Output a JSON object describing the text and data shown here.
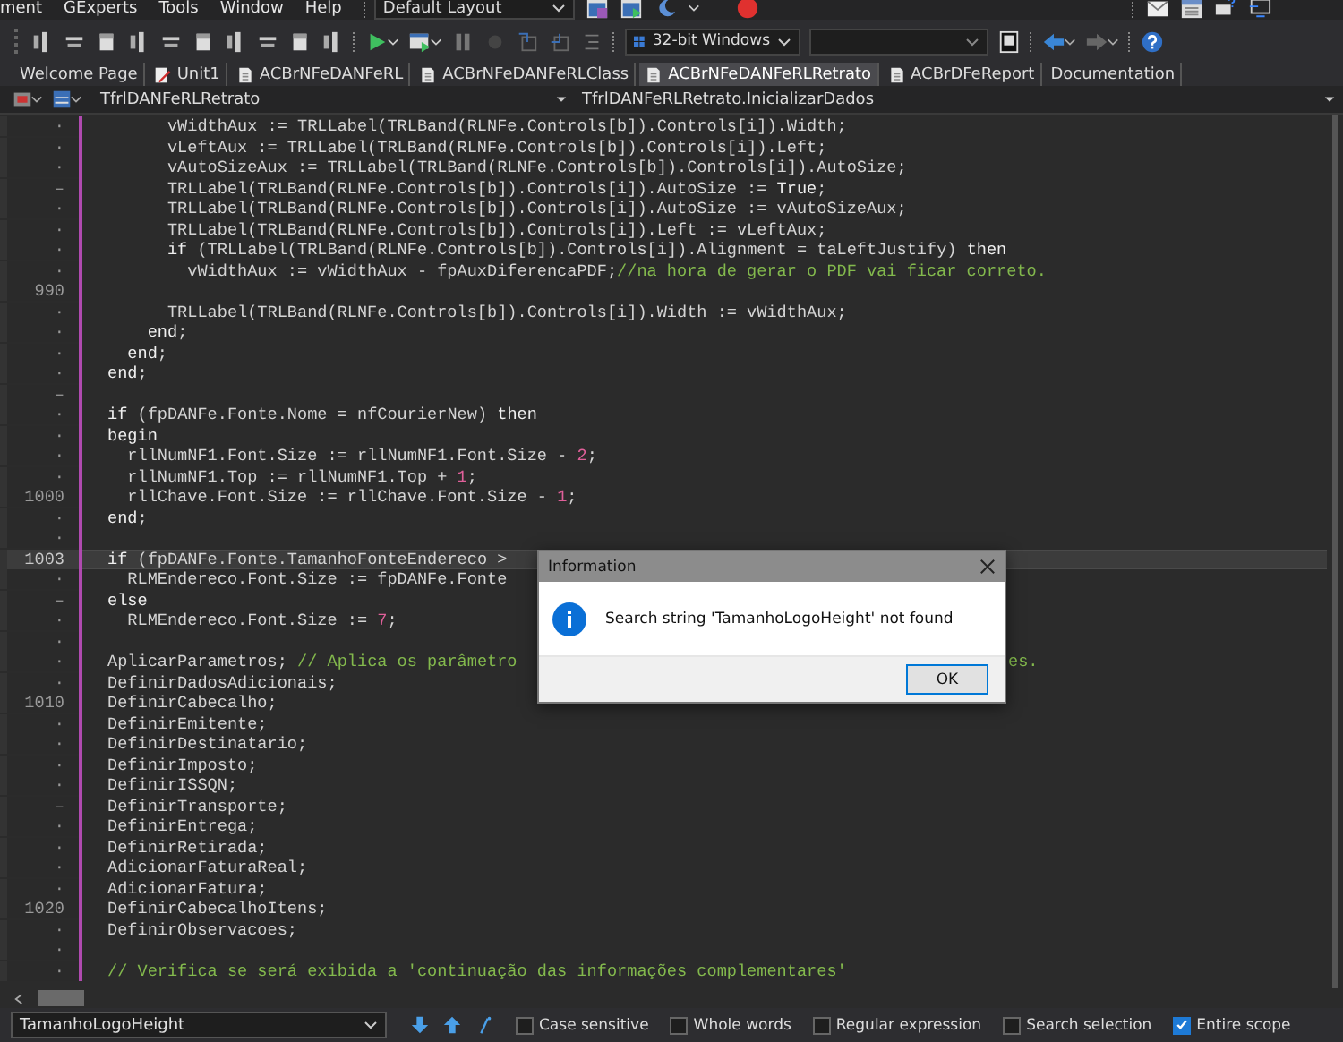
{
  "menu": [
    {
      "label": "ment"
    },
    {
      "label": "GExperts"
    },
    {
      "label": "Tools"
    },
    {
      "label": "Window"
    },
    {
      "label": "Help"
    }
  ],
  "layout_dropdown": {
    "value": "Default Layout"
  },
  "platform_dropdown": {
    "value": "32-bit Windows"
  },
  "tabs": [
    {
      "label": "Welcome Page",
      "kind": "plain",
      "selected": false
    },
    {
      "label": "Unit1",
      "kind": "unit",
      "selected": false
    },
    {
      "label": "ACBrNFeDANFeRL",
      "kind": "file",
      "selected": false
    },
    {
      "label": "ACBrNFeDANFeRLClass",
      "kind": "file",
      "selected": false
    },
    {
      "label": "ACBrNFeDANFeRLRetrato",
      "kind": "file",
      "selected": true
    },
    {
      "label": "ACBrDFeReport",
      "kind": "file",
      "selected": false
    },
    {
      "label": "Documentation",
      "kind": "plain",
      "selected": false
    }
  ],
  "navigation": {
    "class_dropdown": "TfrlDANFeRLRetrato",
    "method": "TfrlDANFeRLRetrato.InicializarDados"
  },
  "code_lines": [
    {
      "gutter": "·",
      "current": false,
      "parts": [
        {
          "kind": "plain",
          "text": "      vWidthAux := TRLLabel(TRLBand(RLNFe.Controls[b]).Controls[i]).Width;"
        }
      ]
    },
    {
      "gutter": "·",
      "current": false,
      "parts": [
        {
          "kind": "plain",
          "text": "      vLeftAux := TRLLabel(TRLBand(RLNFe.Controls[b]).Controls[i]).Left;"
        }
      ]
    },
    {
      "gutter": "·",
      "current": false,
      "parts": [
        {
          "kind": "plain",
          "text": "      vAutoSizeAux := TRLLabel(TRLBand(RLNFe.Controls[b]).Controls[i]).AutoSize;"
        }
      ]
    },
    {
      "gutter": "–",
      "current": false,
      "parts": [
        {
          "kind": "plain",
          "text": "      TRLLabel(TRLBand(RLNFe.Controls[b]).Controls[i]).AutoSize := "
        },
        {
          "kind": "keyword",
          "text": "True"
        },
        {
          "kind": "plain",
          "text": ";"
        }
      ]
    },
    {
      "gutter": "·",
      "current": false,
      "parts": [
        {
          "kind": "plain",
          "text": "      TRLLabel(TRLBand(RLNFe.Controls[b]).Controls[i]).AutoSize := vAutoSizeAux;"
        }
      ]
    },
    {
      "gutter": "·",
      "current": false,
      "parts": [
        {
          "kind": "plain",
          "text": "      TRLLabel(TRLBand(RLNFe.Controls[b]).Controls[i]).Left := vLeftAux;"
        }
      ]
    },
    {
      "gutter": "·",
      "current": false,
      "parts": [
        {
          "kind": "keyword",
          "text": "      if"
        },
        {
          "kind": "plain",
          "text": " (TRLLabel(TRLBand(RLNFe.Controls[b]).Controls[i]).Alignment = taLeftJustify) "
        },
        {
          "kind": "keyword",
          "text": "then"
        }
      ]
    },
    {
      "gutter": "·",
      "current": false,
      "parts": [
        {
          "kind": "plain",
          "text": "        vWidthAux := vWidthAux - fpAuxDiferencaPDF;"
        },
        {
          "kind": "comment",
          "text": "//na hora de gerar o PDF vai ficar correto."
        }
      ]
    },
    {
      "gutter": "990",
      "current": false
    },
    {
      "gutter": "·",
      "current": false,
      "parts": [
        {
          "kind": "plain",
          "text": "      TRLLabel(TRLBand(RLNFe.Controls[b]).Controls[i]).Width := vWidthAux;"
        }
      ]
    },
    {
      "gutter": "·",
      "current": false,
      "parts": [
        {
          "kind": "keyword",
          "text": "    end"
        },
        {
          "kind": "plain",
          "text": ";"
        }
      ]
    },
    {
      "gutter": "·",
      "current": false,
      "parts": [
        {
          "kind": "keyword",
          "text": "  end"
        },
        {
          "kind": "plain",
          "text": ";"
        }
      ]
    },
    {
      "gutter": "·",
      "current": false,
      "parts": [
        {
          "kind": "keyword",
          "text": "end"
        },
        {
          "kind": "plain",
          "text": ";"
        }
      ]
    },
    {
      "gutter": "–",
      "current": false
    },
    {
      "gutter": "·",
      "current": false,
      "parts": [
        {
          "kind": "keyword",
          "text": "if"
        },
        {
          "kind": "plain",
          "text": " (fpDANFe.Fonte.Nome = nfCourierNew) "
        },
        {
          "kind": "keyword",
          "text": "then"
        }
      ]
    },
    {
      "gutter": "·",
      "current": false,
      "parts": [
        {
          "kind": "keyword",
          "text": "begin"
        }
      ]
    },
    {
      "gutter": "·",
      "current": false,
      "parts": [
        {
          "kind": "plain",
          "text": "  rllNumNF1.Font.Size := rllNumNF1.Font.Size - "
        },
        {
          "kind": "number",
          "text": "2"
        },
        {
          "kind": "plain",
          "text": ";"
        }
      ]
    },
    {
      "gutter": "·",
      "current": false,
      "parts": [
        {
          "kind": "plain",
          "text": "  rllNumNF1.Top := rllNumNF1.Top + "
        },
        {
          "kind": "number",
          "text": "1"
        },
        {
          "kind": "plain",
          "text": ";"
        }
      ]
    },
    {
      "gutter": "1000",
      "current": false,
      "parts": [
        {
          "kind": "plain",
          "text": "  rllChave.Font.Size := rllChave.Font.Size - "
        },
        {
          "kind": "number",
          "text": "1"
        },
        {
          "kind": "plain",
          "text": ";"
        }
      ]
    },
    {
      "gutter": "·",
      "current": false,
      "parts": [
        {
          "kind": "keyword",
          "text": "end"
        },
        {
          "kind": "plain",
          "text": ";"
        }
      ]
    },
    {
      "gutter": "·",
      "current": false
    },
    {
      "gutter": "1003",
      "current": true,
      "parts": [
        {
          "kind": "keyword",
          "text": "if"
        },
        {
          "kind": "plain",
          "text": " (fpDANFe.Fonte.TamanhoFonteEndereco >"
        }
      ]
    },
    {
      "gutter": "·",
      "current": false,
      "parts": [
        {
          "kind": "plain",
          "text": "  RLMEndereco.Font.Size := fpDANFe.Fonte"
        }
      ]
    },
    {
      "gutter": "–",
      "current": false,
      "parts": [
        {
          "kind": "keyword",
          "text": "else"
        }
      ]
    },
    {
      "gutter": "·",
      "current": false,
      "parts": [
        {
          "kind": "plain",
          "text": "  RLMEndereco.Font.Size := "
        },
        {
          "kind": "number",
          "text": "7"
        },
        {
          "kind": "plain",
          "text": ";"
        }
      ]
    },
    {
      "gutter": "·",
      "current": false
    },
    {
      "gutter": "·",
      "current": false,
      "parts": [
        {
          "kind": "plain",
          "text": "AplicarParametros; "
        },
        {
          "kind": "comment",
          "text": "// Aplica os parâmetro"
        }
      ],
      "tail": "es."
    },
    {
      "gutter": "·",
      "current": false,
      "parts": [
        {
          "kind": "plain",
          "text": "DefinirDadosAdicionais;"
        }
      ]
    },
    {
      "gutter": "1010",
      "current": false,
      "parts": [
        {
          "kind": "plain",
          "text": "DefinirCabecalho;"
        }
      ]
    },
    {
      "gutter": "·",
      "current": false,
      "parts": [
        {
          "kind": "plain",
          "text": "DefinirEmitente;"
        }
      ]
    },
    {
      "gutter": "·",
      "current": false,
      "parts": [
        {
          "kind": "plain",
          "text": "DefinirDestinatario;"
        }
      ]
    },
    {
      "gutter": "·",
      "current": false,
      "parts": [
        {
          "kind": "plain",
          "text": "DefinirImposto;"
        }
      ]
    },
    {
      "gutter": "·",
      "current": false,
      "parts": [
        {
          "kind": "plain",
          "text": "DefinirISSQN;"
        }
      ]
    },
    {
      "gutter": "–",
      "current": false,
      "parts": [
        {
          "kind": "plain",
          "text": "DefinirTransporte;"
        }
      ]
    },
    {
      "gutter": "·",
      "current": false,
      "parts": [
        {
          "kind": "plain",
          "text": "DefinirEntrega;"
        }
      ]
    },
    {
      "gutter": "·",
      "current": false,
      "parts": [
        {
          "kind": "plain",
          "text": "DefinirRetirada;"
        }
      ]
    },
    {
      "gutter": "·",
      "current": false,
      "parts": [
        {
          "kind": "plain",
          "text": "AdicionarFaturaReal;"
        }
      ]
    },
    {
      "gutter": "·",
      "current": false,
      "parts": [
        {
          "kind": "plain",
          "text": "AdicionarFatura;"
        }
      ]
    },
    {
      "gutter": "1020",
      "current": false,
      "parts": [
        {
          "kind": "plain",
          "text": "DefinirCabecalhoItens;"
        }
      ]
    },
    {
      "gutter": "·",
      "current": false,
      "parts": [
        {
          "kind": "plain",
          "text": "DefinirObservacoes;"
        }
      ]
    },
    {
      "gutter": "·",
      "current": false
    },
    {
      "gutter": "·",
      "current": false,
      "parts": [
        {
          "kind": "comment",
          "text": "// Verifica se será exibida a 'continuação das informações complementares'"
        }
      ]
    }
  ],
  "dialog": {
    "title": "Information",
    "message": "Search string 'TamanhoLogoHeight' not found",
    "button": "OK"
  },
  "find_bar": {
    "value": "TamanhoLogoHeight",
    "options": [
      {
        "label": "Case sensitive",
        "checked": false
      },
      {
        "label": "Whole words",
        "checked": false
      },
      {
        "label": "Regular expression",
        "checked": false
      },
      {
        "label": "Search selection",
        "checked": false
      },
      {
        "label": "Entire scope",
        "checked": true
      }
    ]
  }
}
